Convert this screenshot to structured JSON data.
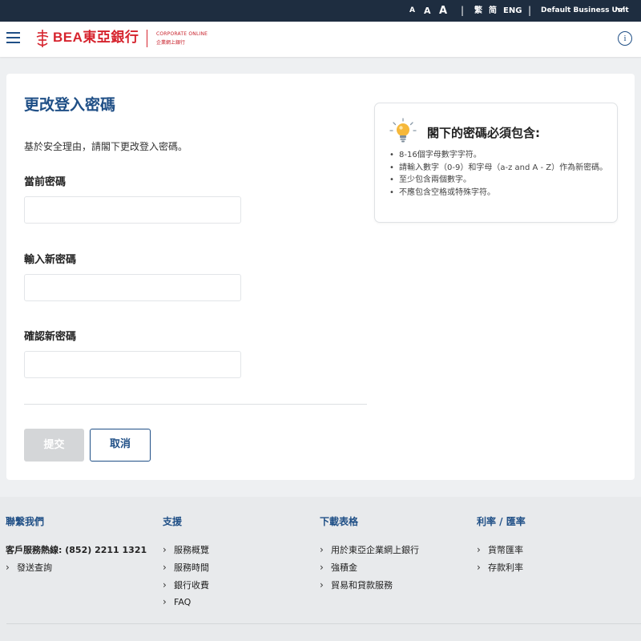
{
  "topbar": {
    "font_small": "A",
    "font_medium": "A",
    "font_large": "A",
    "lang_traditional": "繁",
    "lang_simplified": "简",
    "lang_english": "ENG",
    "business_unit": "Default Business Unit",
    "separator": "|"
  },
  "header": {
    "logo_text": "BEA東亞銀行",
    "logo_sub_en": "CORPORATE ONLINE",
    "logo_sub_zh": "企業網上銀行",
    "info_icon": "i"
  },
  "form": {
    "title": "更改登入密碼",
    "intro": "基於安全理由，請閣下更改登入密碼。",
    "current_label": "當前密碼",
    "current_value": "",
    "new_label": "輸入新密碼",
    "new_value": "",
    "confirm_label": "確認新密碼",
    "confirm_value": "",
    "submit_label": "提交",
    "cancel_label": "取消"
  },
  "tips": {
    "title": "閣下的密碼必須包含:",
    "items": [
      "8-16個字母數字字符。",
      "請輸入數字（0-9）和字母（a-z and A - Z）作為新密碼。",
      "至少包含兩個數字。",
      "不應包含空格或特殊字符。"
    ]
  },
  "footer": {
    "contact": {
      "heading": "聯繫我們",
      "hotline": "客戶服務熱線: (852) 2211 1321",
      "links": [
        "發送查詢"
      ]
    },
    "support": {
      "heading": "支援",
      "links": [
        "服務概覽",
        "服務時間",
        "銀行收費",
        "FAQ"
      ]
    },
    "downloads": {
      "heading": "下載表格",
      "links": [
        "用於東亞企業網上銀行",
        "強積金",
        "貿易和貸款服務"
      ]
    },
    "rates": {
      "heading": "利率 / 匯率",
      "links": [
        "貨幣匯率",
        "存款利率"
      ]
    }
  },
  "icons": {
    "menu": "hamburger-icon",
    "info": "info-icon",
    "dropdown": "chevron-down-icon",
    "tips": "lightbulb-icon",
    "link_arrow": "chevron-right-icon"
  },
  "colors": {
    "primary": "#1f4f86",
    "brand_red": "#d6242e",
    "topbar": "#1e2d40",
    "disabled": "#d4d6d8"
  }
}
